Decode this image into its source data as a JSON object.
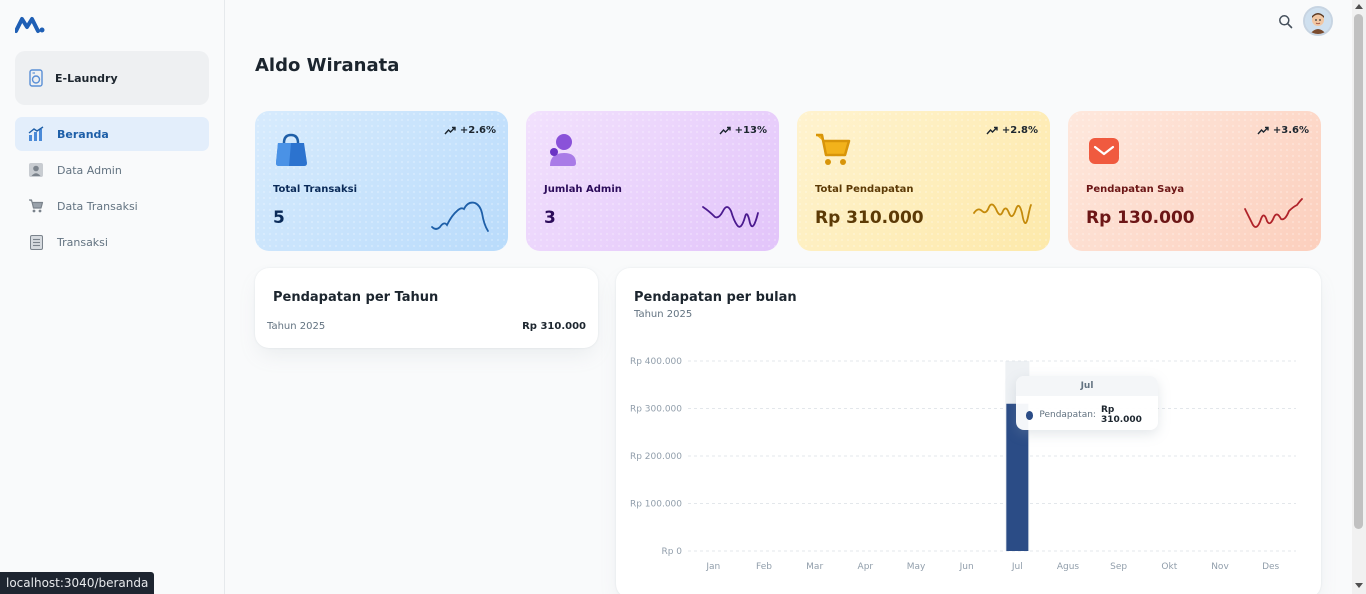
{
  "app": {
    "workspace_name": "E-Laundry"
  },
  "sidebar": {
    "items": [
      {
        "label": "Beranda",
        "icon": "chart-icon",
        "active": true
      },
      {
        "label": "Data Admin",
        "icon": "user-icon",
        "active": false
      },
      {
        "label": "Data Transaksi",
        "icon": "cart-icon",
        "active": false
      },
      {
        "label": "Transaksi",
        "icon": "document-icon",
        "active": false
      }
    ]
  },
  "status_bar": {
    "url": "localhost:3040/beranda"
  },
  "header": {
    "title": "Aldo Wiranata"
  },
  "stats": [
    {
      "title": "Total Transaksi",
      "value": "5",
      "trend": "+2.6%",
      "icon": "bag-icon",
      "color": "#1e5fa8"
    },
    {
      "title": "Jumlah Admin",
      "value": "3",
      "trend": "+13%",
      "icon": "user-icon",
      "color": "#4b1a8f"
    },
    {
      "title": "Total Pendapatan",
      "value": "Rp 310.000",
      "trend": "+2.8%",
      "icon": "cart-icon",
      "color": "#c48a0b"
    },
    {
      "title": "Pendapatan Saya",
      "value": "Rp 130.000",
      "trend": "+3.6%",
      "icon": "mail-icon",
      "color": "#b0232a"
    }
  ],
  "yearly": {
    "title": "Pendapatan per Tahun",
    "row_label": "Tahun 2025",
    "row_value": "Rp 310.000"
  },
  "monthly": {
    "title": "Pendapatan per bulan",
    "subtitle": "Tahun 2025",
    "tooltip": {
      "header": "Jul",
      "series": "Pendapatan:",
      "value": "Rp 310.000"
    }
  },
  "chart_data": {
    "type": "bar",
    "title": "Pendapatan per bulan",
    "subtitle": "Tahun 2025",
    "categories": [
      "Jan",
      "Feb",
      "Mar",
      "Apr",
      "May",
      "Jun",
      "Jul",
      "Agus",
      "Sep",
      "Okt",
      "Nov",
      "Des"
    ],
    "series": [
      {
        "name": "Pendapatan",
        "values": [
          0,
          0,
          0,
          0,
          0,
          0,
          310000,
          0,
          0,
          0,
          0,
          0
        ]
      }
    ],
    "ylim": [
      0,
      400000
    ],
    "yticks": [
      0,
      100000,
      200000,
      300000,
      400000
    ],
    "ytick_labels": [
      "Rp 0",
      "Rp 100.000",
      "Rp 200.000",
      "Rp 300.000",
      "Rp 400.000"
    ],
    "grid": true,
    "bar_color": "#2b4c86"
  }
}
